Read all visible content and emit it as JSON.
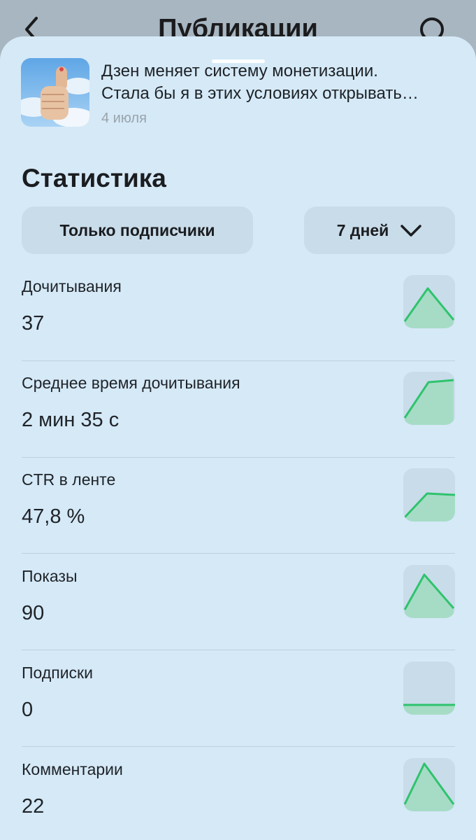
{
  "header": {
    "title": "Публикации",
    "back_icon": "chevron-left-icon",
    "search_icon": "search-icon"
  },
  "publication": {
    "thumbnail": "thumbs-up-photo",
    "title_line1": "Дзен меняет систему монетизации.",
    "title_line2": "Стала бы я в этих условиях открывать…",
    "date": "4 июля"
  },
  "stats": {
    "title": "Статистика",
    "filter_audience": "Только подписчики",
    "filter_period": "7 дней",
    "period_icon": "chevron-down-icon",
    "metrics": [
      {
        "label": "Дочитывания",
        "value": "37",
        "trend": "peak"
      },
      {
        "label": "Среднее время дочитывания",
        "value": "2 мин 35 с",
        "trend": "rise-plateau"
      },
      {
        "label": "CTR в ленте",
        "value": "47,8 %",
        "trend": "rise-plateau-low"
      },
      {
        "label": "Показы",
        "value": "90",
        "trend": "peak"
      },
      {
        "label": "Подписки",
        "value": "0",
        "trend": "flat"
      },
      {
        "label": "Комментарии",
        "value": "22",
        "trend": "peak"
      }
    ]
  },
  "colors": {
    "background": "#a7b6c0",
    "sheet": "#d5e9f7",
    "pill": "#c9dcea",
    "chart_line": "#2fc36d",
    "chart_fill": "#a6dcc6"
  }
}
